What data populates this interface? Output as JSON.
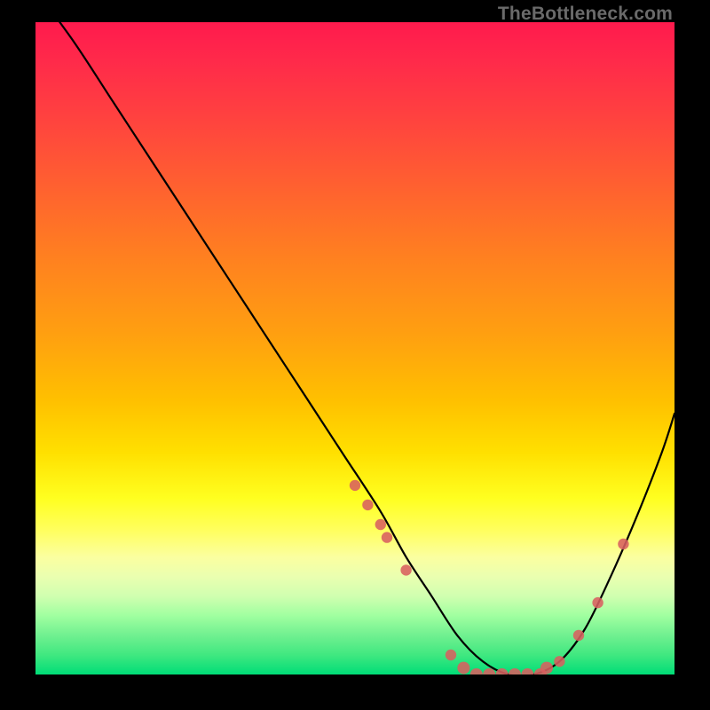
{
  "watermark": "TheBottleneck.com",
  "chart_data": {
    "type": "line",
    "title": "",
    "xlabel": "",
    "ylabel": "",
    "xlim": [
      0,
      100
    ],
    "ylim": [
      0,
      100
    ],
    "series": [
      {
        "name": "bottleneck-curve",
        "x": [
          0,
          6,
          12,
          18,
          24,
          30,
          36,
          42,
          48,
          54,
          58,
          62,
          66,
          70,
          74,
          78,
          82,
          86,
          90,
          94,
          98,
          100
        ],
        "y": [
          105,
          97,
          88,
          79,
          70,
          61,
          52,
          43,
          34,
          25,
          18,
          12,
          6,
          2,
          0,
          0,
          2,
          7,
          15,
          24,
          34,
          40
        ]
      }
    ],
    "markers": {
      "name": "highlight-points",
      "color": "#d86060",
      "x": [
        50,
        52,
        54,
        55,
        58,
        65,
        67,
        69,
        71,
        73,
        75,
        77,
        79,
        80,
        82,
        85,
        88,
        92
      ],
      "y": [
        29,
        26,
        23,
        21,
        16,
        3,
        1,
        0,
        0,
        0,
        0,
        0,
        0,
        1,
        2,
        6,
        11,
        20
      ]
    }
  }
}
